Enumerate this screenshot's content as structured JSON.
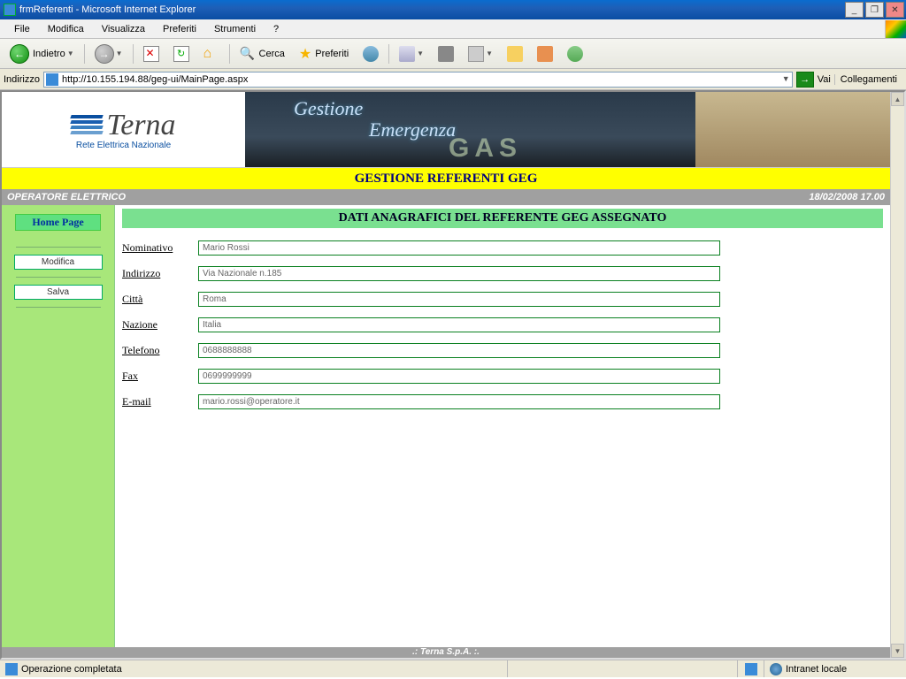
{
  "window": {
    "title": "frmReferenti - Microsoft Internet Explorer"
  },
  "menubar": {
    "file": "File",
    "modifica": "Modifica",
    "visualizza": "Visualizza",
    "preferiti": "Preferiti",
    "strumenti": "Strumenti",
    "help": "?"
  },
  "toolbar": {
    "indietro": "Indietro",
    "cerca": "Cerca",
    "preferiti": "Preferiti"
  },
  "addressbar": {
    "label": "Indirizzo",
    "url": "http://10.155.194.88/geg-ui/MainPage.aspx",
    "vai": "Vai",
    "collegamenti": "Collegamenti"
  },
  "banner": {
    "logo_main": "Terna",
    "logo_sub": "Rete Elettrica Nazionale",
    "overlay1": "Gestione",
    "overlay2": "Emergenza",
    "overlay3": "GAS",
    "yellow_title": "GESTIONE REFERENTI GEG"
  },
  "rolebar": {
    "role": "OPERATORE ELETTRICO",
    "datetime": "18/02/2008 17.00"
  },
  "sidebar": {
    "home": "Home Page",
    "modifica": "Modifica",
    "salva": "Salva"
  },
  "form": {
    "title": "DATI ANAGRAFICI DEL REFERENTE GEG ASSEGNATO",
    "fields": [
      {
        "label": "Nominativo",
        "value": "Mario Rossi"
      },
      {
        "label": "Indirizzo",
        "value": "Via Nazionale n.185"
      },
      {
        "label": "Città",
        "value": "Roma"
      },
      {
        "label": "Nazione",
        "value": "Italia"
      },
      {
        "label": "Telefono",
        "value": "0688888888"
      },
      {
        "label": "Fax",
        "value": "0699999999"
      },
      {
        "label": "E-mail",
        "value": "mario.rossi@operatore.it"
      }
    ]
  },
  "footer": {
    "text": ".: Terna S.p.A. :."
  },
  "statusbar": {
    "status": "Operazione completata",
    "zone": "Intranet locale"
  }
}
